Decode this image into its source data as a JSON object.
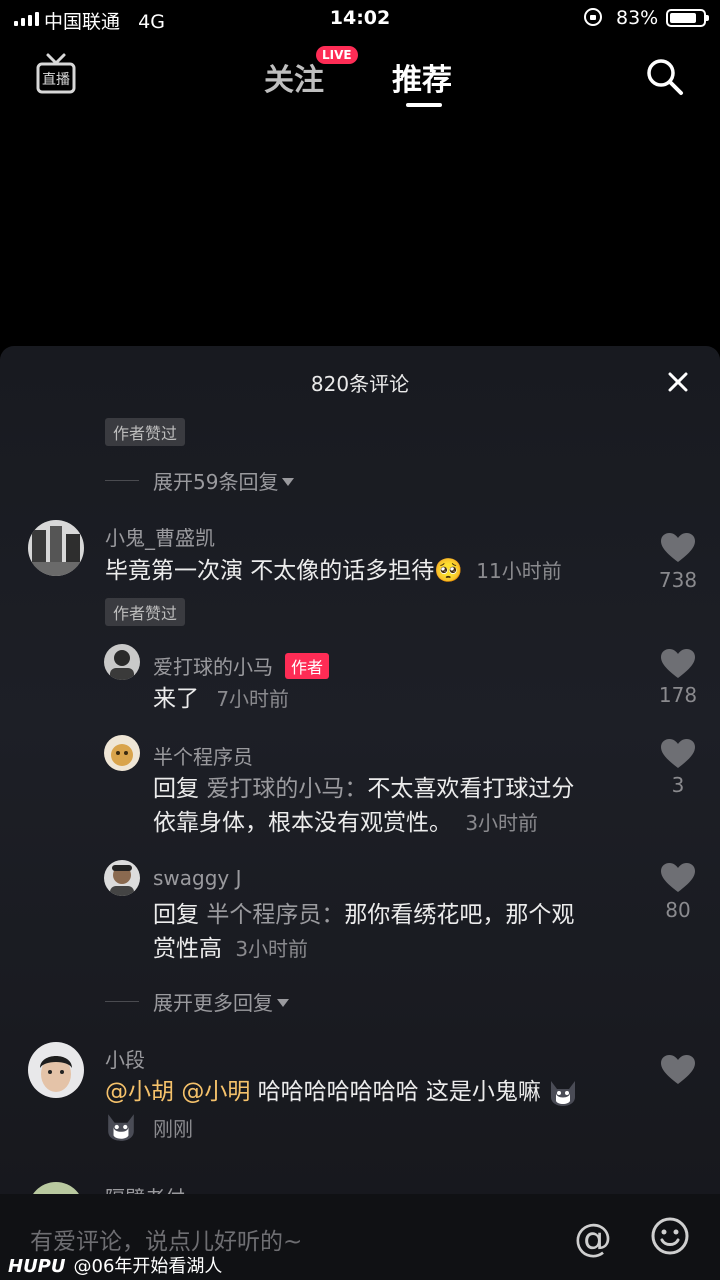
{
  "status": {
    "carrier": "中国联通",
    "network": "4G",
    "time": "14:02",
    "battery": "83%",
    "battery_level": 0.83
  },
  "nav": {
    "follow": "关注",
    "live_badge": "LIVE",
    "recommend": "推荐",
    "live_icon": "live-broadcast-icon",
    "search_icon": "search-icon"
  },
  "sheet": {
    "title": "820条评论",
    "close_icon": "close-icon"
  },
  "top": {
    "author_liked": "作者赞过",
    "expand": "展开59条回复"
  },
  "comment1": {
    "name": "小鬼_曹盛凯",
    "text": "毕竟第一次演 不太像的话多担待",
    "emoji": "🥺",
    "time": "11小时前",
    "likes": "738",
    "author_liked": "作者赞过"
  },
  "reply1": {
    "name": "爱打球的小马",
    "badge": "作者",
    "text": "来了",
    "time": "7小时前",
    "likes": "178"
  },
  "reply2": {
    "name": "半个程序员",
    "prefix": "回复",
    "target": "爱打球的小马：",
    "line1": "不太喜欢看打球过分",
    "line2": "依靠身体，根本没有观赏性。",
    "time": "3小时前",
    "likes": "3"
  },
  "reply3": {
    "name": "swaggy J",
    "prefix": "回复",
    "target": "半个程序员：",
    "line1": "那你看绣花吧，那个观",
    "line2": "赏性高",
    "time": "3小时前",
    "likes": "80"
  },
  "expand_more": "展开更多回复",
  "comment2": {
    "name": "小段",
    "mention1": "@小胡",
    "mention2": "@小明",
    "text": "哈哈哈哈哈哈哈 这是小鬼嘛",
    "time": "刚刚"
  },
  "comment3": {
    "name": "隔壁老付"
  },
  "input": {
    "placeholder": "有爱评论，说点儿好听的~",
    "at_icon": "@",
    "emoji_icon": "smile-icon"
  },
  "watermark": {
    "brand": "HUPU",
    "text": "@06年开始看湖人"
  },
  "colors": {
    "accent": "#fe2c55",
    "mention": "#f5c26b",
    "sheet_bg": "#1d1f26"
  }
}
